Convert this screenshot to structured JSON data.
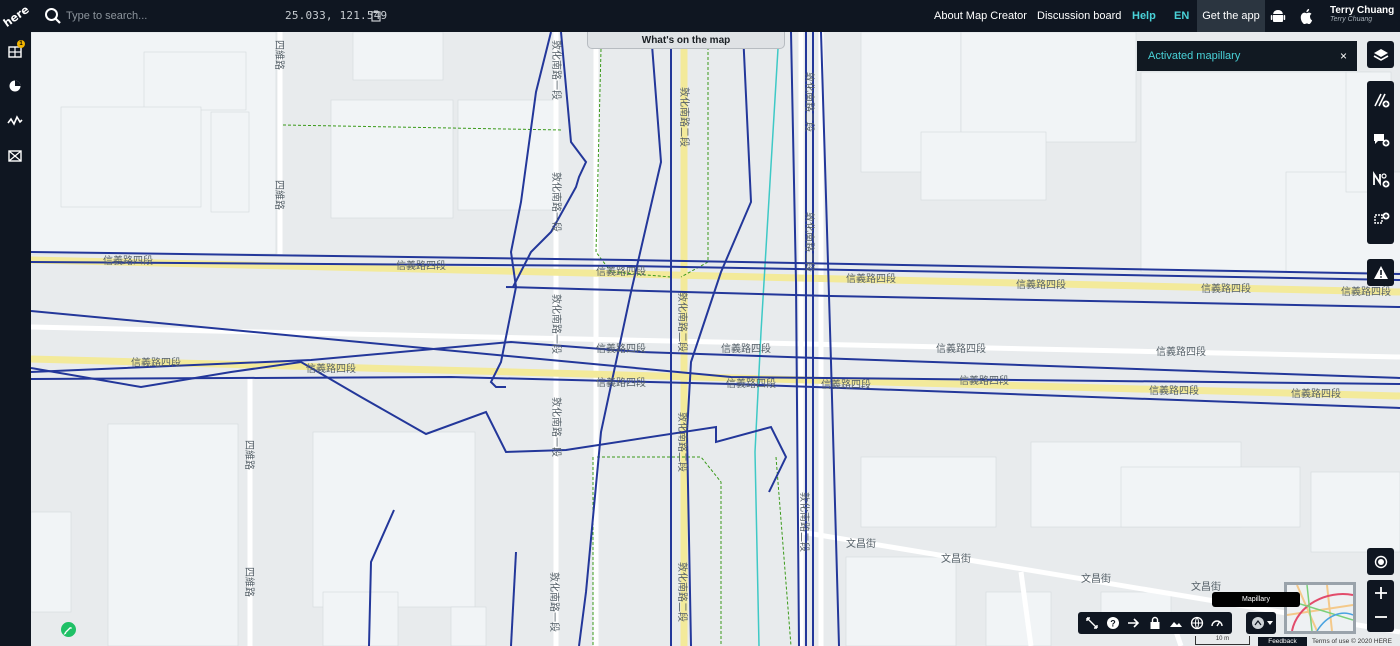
{
  "brand": {
    "logo_text": "here"
  },
  "search": {
    "placeholder": "Type to search..."
  },
  "coords": {
    "text": "25.033, 121.549"
  },
  "nav": {
    "about": "About Map Creator",
    "discussion": "Discussion board",
    "help": "Help",
    "lang": "EN",
    "get_app": "Get the app"
  },
  "user": {
    "name": "Terry Chuang",
    "subtitle": "Terry Chuang"
  },
  "sidebar": {
    "badge": "1"
  },
  "map": {
    "whats_on_map": "What's on the map",
    "toast": "Activated mapillary",
    "toast_close": "×",
    "street_labels": {
      "xinyi": "信義路四段",
      "dunhua_upper": "敦化南路一段",
      "dunhua_lower": "敦化南路二段",
      "siwei": "四維路",
      "wenchang": "文昌街"
    }
  },
  "bottom": {
    "tooltip": "Mapillary",
    "scale": "10 m",
    "feedback": "Feedback",
    "terms": "Terms of use © 2020 HERE"
  },
  "colors": {
    "topbar": "#0f1621",
    "accent": "#49d2d8",
    "road_major": "#f3ea9a",
    "mapillary_line": "#23379a",
    "teal_line": "#3ec9c6",
    "green_dashed": "#3a9a1a"
  }
}
